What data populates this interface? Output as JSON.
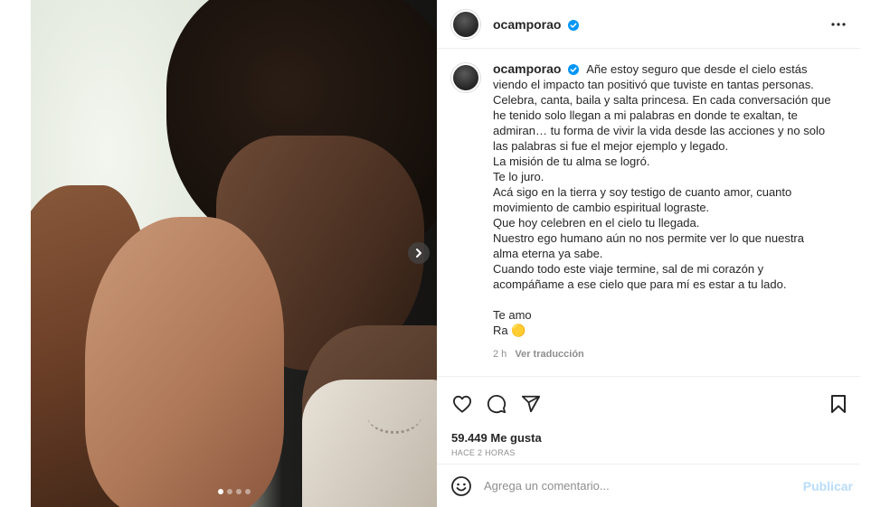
{
  "post": {
    "username": "ocamporao",
    "caption_lines": [
      "Añe estoy seguro que desde el cielo estás",
      "viendo el impacto tan positivó que tuviste en tantas personas.",
      "Celebra, canta, baila y salta princesa. En cada conversación que",
      "he tenido solo llegan a mi palabras en donde te exaltan, te",
      "admiran… tu forma de vivir la vida desde las acciones y no solo",
      "las palabras si fue el mejor ejemplo y legado.",
      "La misión de tu alma se logró.",
      "Te lo juro.",
      "Acá sigo en la tierra y soy testigo de cuanto amor, cuanto",
      "movimiento de cambio espiritual lograste.",
      "Que hoy celebren en el cielo tu llegada.",
      "Nuestro ego humano aún no nos permite ver lo que nuestra",
      "alma eterna ya sabe.",
      "Cuando todo este viaje termine, sal de mi corazón y",
      "acompáñame a ese cielo que para mí es estar a tu lado.",
      "",
      "Te amo",
      "Ra 🟡"
    ],
    "caption_age": "2 h",
    "translate_label": "Ver traducción",
    "likes": "59.449 Me gusta",
    "posted": "HACE 2 HORAS",
    "carousel": {
      "count": 4,
      "active_index": 0
    }
  },
  "comment": {
    "placeholder": "Agrega un comentario...",
    "publish_label": "Publicar"
  },
  "colors": {
    "verified_blue": "#0095f6",
    "publish_disabled": "#b9dcfb",
    "muted_text": "#8e8e8e"
  },
  "icons": [
    "verified-icon",
    "more-icon",
    "next-arrow-icon",
    "heart-icon",
    "comment-icon",
    "share-icon",
    "bookmark-icon",
    "emoji-icon"
  ]
}
